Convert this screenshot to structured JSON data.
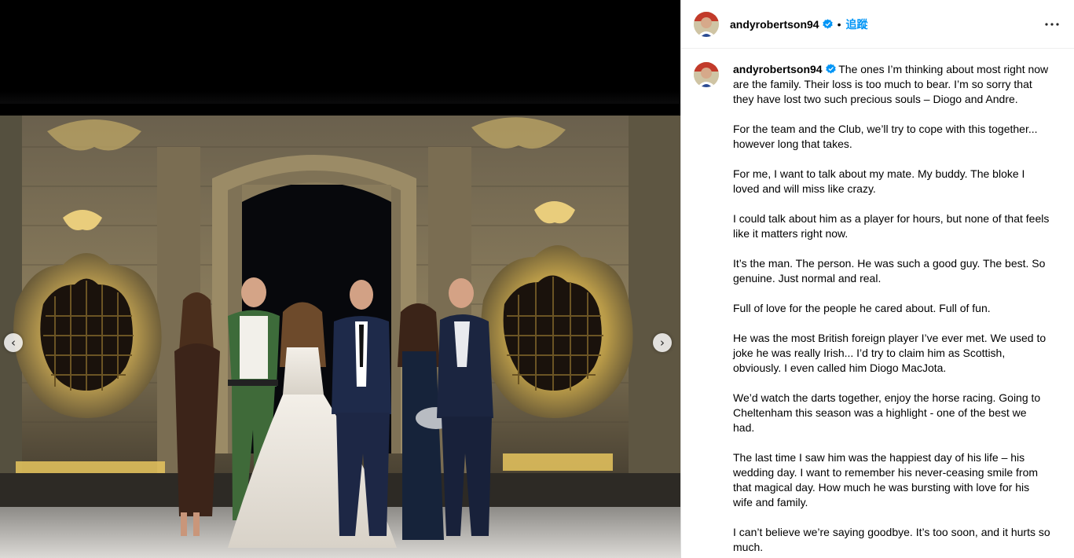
{
  "post": {
    "username": "andyrobertson94",
    "follow_label": "追蹤",
    "separator": "•",
    "more_icon": "more-horizontal-icon",
    "verified_icon": "verified-badge-icon"
  },
  "carousel": {
    "prev_icon": "chevron-left-icon",
    "next_icon": "chevron-right-icon",
    "prev_glyph": "‹",
    "next_glyph": "›"
  },
  "caption": {
    "username": "andyrobertson94",
    "paragraphs": [
      "The ones I’m thinking about most right now are the family. Their loss is too much to bear. I’m so sorry that they have lost two such precious souls – Diogo and Andre.",
      "For the team and the Club, we’ll try to cope with this together... however long that takes.",
      "For me, I want to talk about my mate. My buddy. The bloke I loved and will miss like crazy.",
      "I could talk about him as a player for hours, but none of that feels like it matters right now.",
      "It’s the man. The person. He was such a good guy. The best. So genuine. Just normal and real.",
      "Full of love for the people he cared about. Full of fun.",
      "He was the most British foreign player I’ve ever met. We used to joke he was really Irish... I’d try to claim him as Scottish, obviously. I even called him Diogo MacJota.",
      "We’d watch the darts together, enjoy the horse racing. Going to Cheltenham this season was a highlight - one of the best we had.",
      "The last time I saw him was the happiest day of his life – his wedding day. I want to remember his never-ceasing smile from that magical day. How much he was bursting with love for his wife and family.",
      "I can’t believe we’re saying goodbye. It’s too soon, and it hurts so much."
    ]
  },
  "colors": {
    "accent": "#0095f6",
    "verified": "#0095f6",
    "stone_light": "#d9c27a",
    "stone_dark": "#3a3328"
  }
}
